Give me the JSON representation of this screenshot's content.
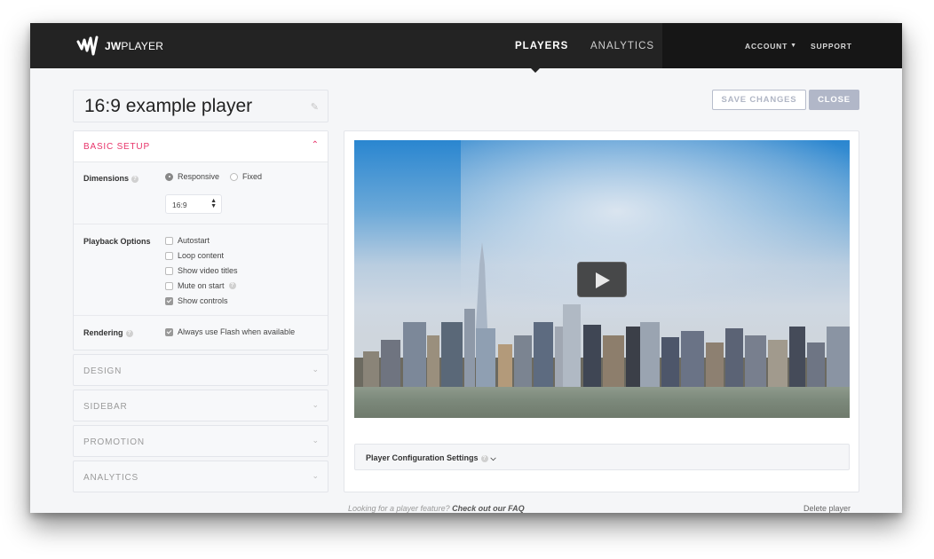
{
  "header": {
    "logo_text_bold": "JW",
    "logo_text": "PLAYER",
    "nav": [
      {
        "label": "PLAYERS",
        "active": true
      },
      {
        "label": "ANALYTICS",
        "active": false
      }
    ],
    "account_label": "ACCOUNT",
    "account_icon": "chevron-down-icon",
    "support_label": "SUPPORT"
  },
  "player": {
    "title": "16:9 example player",
    "edit_icon": "pencil-icon"
  },
  "actions": {
    "save_label": "SAVE CHANGES",
    "close_label": "CLOSE"
  },
  "basic_setup": {
    "title": "BASIC SETUP",
    "expanded": true,
    "dimensions": {
      "label": "Dimensions",
      "options": [
        {
          "label": "Responsive",
          "selected": true
        },
        {
          "label": "Fixed",
          "selected": false
        }
      ],
      "aspect_ratio": "16:9"
    },
    "playback": {
      "label": "Playback Options",
      "options": [
        {
          "label": "Autostart",
          "checked": false
        },
        {
          "label": "Loop content",
          "checked": false
        },
        {
          "label": "Show video titles",
          "checked": false
        },
        {
          "label": "Mute on start",
          "checked": false,
          "help": true
        },
        {
          "label": "Show controls",
          "checked": true
        }
      ]
    },
    "rendering": {
      "label": "Rendering",
      "option": {
        "label": "Always use Flash when available",
        "checked": true
      }
    }
  },
  "sections": [
    {
      "label": "DESIGN"
    },
    {
      "label": "SIDEBAR"
    },
    {
      "label": "PROMOTION"
    },
    {
      "label": "ANALYTICS"
    }
  ],
  "preview": {
    "play_icon": "play-icon",
    "config_label": "Player Configuration Settings"
  },
  "footer": {
    "faq_prefix": "Looking for a player feature?",
    "faq_link": "Check out our FAQ",
    "delete_label": "Delete player"
  },
  "colors": {
    "accent": "#e8346a",
    "topbar": "#232323",
    "close_button": "#b1b7c8"
  }
}
